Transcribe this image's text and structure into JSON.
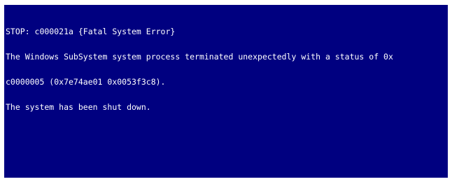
{
  "bsod": {
    "background_color": "#000080",
    "text_color": "#ffffff",
    "lines": [
      "STOP: c000021a {Fatal System Error}",
      "The Windows SubSystem system process terminated unexpectedly with a status of 0x",
      "c0000005 (0x7e74ae01 0x0053f3c8).",
      "The system has been shut down."
    ]
  }
}
